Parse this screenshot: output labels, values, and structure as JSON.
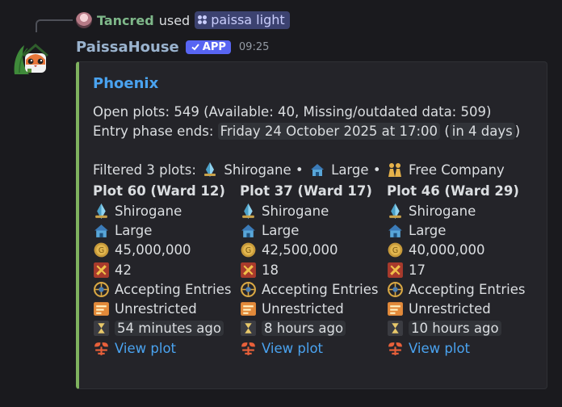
{
  "reply": {
    "user": "Tancred",
    "used_text": "used",
    "command": "paissa light"
  },
  "author": {
    "name": "PaissaHouse",
    "tag": "APP",
    "time": "09:25"
  },
  "embed": {
    "title": "Phoenix",
    "open_plots_line": "Open plots: 549 (Available: 40, Missing/outdated data: 509)",
    "entry_phase_label": "Entry phase ends:",
    "entry_phase_date": "Friday 24 October 2025 at 17:00",
    "entry_phase_relative": "in 4 days",
    "filtered": {
      "prefix": "Filtered 3 plots:",
      "district": "Shirogane",
      "size": "Large",
      "purchaser": "Free Company",
      "sep": "•"
    },
    "plots": [
      {
        "name": "Plot 60 (Ward 12)",
        "district": "Shirogane",
        "size": "Large",
        "price": "45,000,000",
        "entries": "42",
        "phase": "Accepting Entries",
        "restriction": "Unrestricted",
        "updated": "54 minutes ago",
        "link": "View plot"
      },
      {
        "name": "Plot 37 (Ward 17)",
        "district": "Shirogane",
        "size": "Large",
        "price": "42,500,000",
        "entries": "18",
        "phase": "Accepting Entries",
        "restriction": "Unrestricted",
        "updated": "8 hours ago",
        "link": "View plot"
      },
      {
        "name": "Plot 46 (Ward 29)",
        "district": "Shirogane",
        "size": "Large",
        "price": "40,000,000",
        "entries": "17",
        "phase": "Accepting Entries",
        "restriction": "Unrestricted",
        "updated": "10 hours ago",
        "link": "View plot"
      }
    ]
  },
  "colors": {
    "embed_border": "#7fb25f",
    "link": "#4aa3f0",
    "app_tag": "#5865f2"
  },
  "icons": [
    "crystal-icon",
    "house-icon",
    "gil-coin-icon",
    "entries-icon",
    "lottery-icon",
    "unrestricted-icon",
    "hourglass-icon",
    "link-icon",
    "free-company-icon"
  ]
}
